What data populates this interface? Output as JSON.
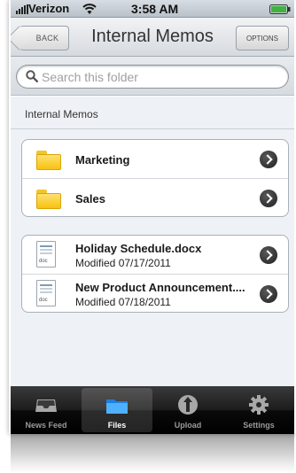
{
  "status_bar": {
    "carrier": "Verizon",
    "time": "3:58 AM",
    "icons": [
      "signal-icon",
      "wifi-icon",
      "battery-icon"
    ]
  },
  "nav_bar": {
    "back_label": "BACK",
    "title": "Internal Memos",
    "options_label": "OPTIONS"
  },
  "search": {
    "placeholder": "Search this folder",
    "value": ""
  },
  "section": {
    "label": "Internal Memos"
  },
  "folders": [
    {
      "name": "Marketing",
      "icon": "folder-icon"
    },
    {
      "name": "Sales",
      "icon": "folder-icon"
    }
  ],
  "files": [
    {
      "name": "Holiday Schedule.docx",
      "modified": "Modified 07/17/2011",
      "type_tag": "doc",
      "icon": "doc-icon"
    },
    {
      "name": "New Product Announcement....",
      "modified": "Modified 07/18/2011",
      "type_tag": "doc",
      "icon": "doc-icon"
    }
  ],
  "tab_bar": {
    "tabs": [
      {
        "label": "News Feed",
        "icon": "inbox-icon"
      },
      {
        "label": "Files",
        "icon": "folder-icon"
      },
      {
        "label": "Upload",
        "icon": "upload-icon"
      },
      {
        "label": "Settings",
        "icon": "gear-icon"
      }
    ],
    "selected": "Files"
  },
  "colors": {
    "folder": "#f7c20e",
    "tab_bar": "#1c1c1c",
    "content_bg": "#eef2f6"
  }
}
